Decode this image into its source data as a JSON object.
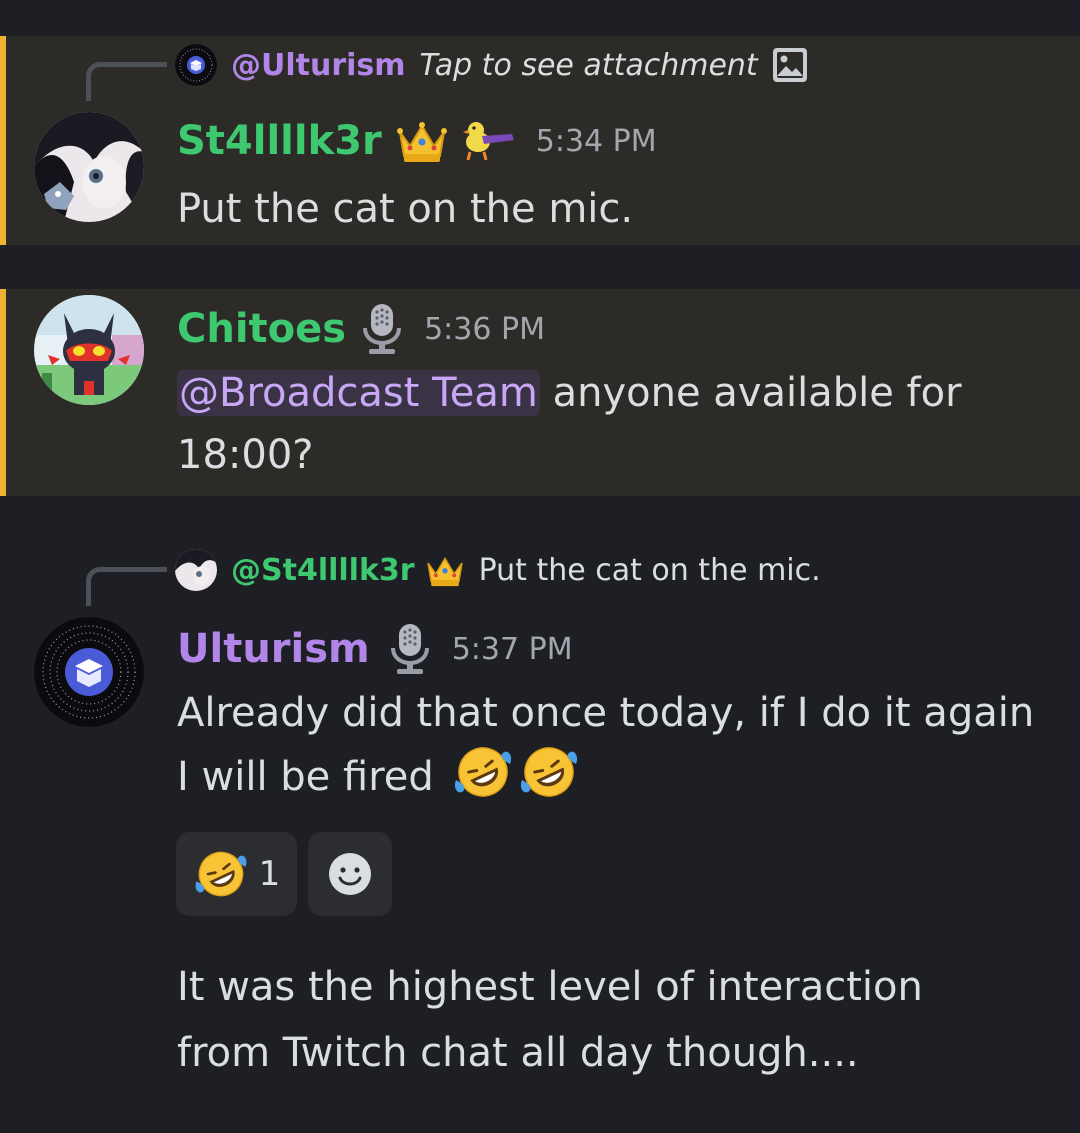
{
  "colors": {
    "background": "#1e1f24",
    "highlight_background": "#2c2b27",
    "highlight_bar": "#f0b232",
    "name_green": "#3ec870",
    "name_purple": "#b186e8",
    "timestamp": "#a3a6ad",
    "mention_bg": "#3a3245",
    "mention_text": "#c9a7f7"
  },
  "messages": [
    {
      "highlighted": true,
      "reply": {
        "name": "@Ulturism",
        "text": "Tap to see attachment",
        "icon": "image-icon"
      },
      "author": "St4llllk3r",
      "badges": [
        "crown-icon",
        "duck-icon"
      ],
      "time": "5:34 PM",
      "text": "Put the cat on the mic."
    },
    {
      "highlighted": true,
      "author": "Chitoes",
      "badges": [
        "microphone-icon"
      ],
      "time": "5:36 PM",
      "mention": "@Broadcast Team",
      "text_line1": "anyone available for",
      "text_line2": "18:00?"
    },
    {
      "highlighted": false,
      "reply": {
        "name": "@St4llllk3r",
        "text": "Put the cat on the mic.",
        "icon": "crown-icon"
      },
      "author": "Ulturism",
      "badges": [
        "microphone-icon"
      ],
      "time": "5:37 PM",
      "text_line1": "Already did that once today, if I do it again",
      "text_line2": "I will be fired",
      "reactions": [
        {
          "emoji": "rofl-emoji",
          "count": "1"
        },
        {
          "emoji": "add-reaction-icon"
        }
      ],
      "followup_line1": "It was the highest level of interaction",
      "followup_line2": "from Twitch chat all day though...."
    }
  ]
}
